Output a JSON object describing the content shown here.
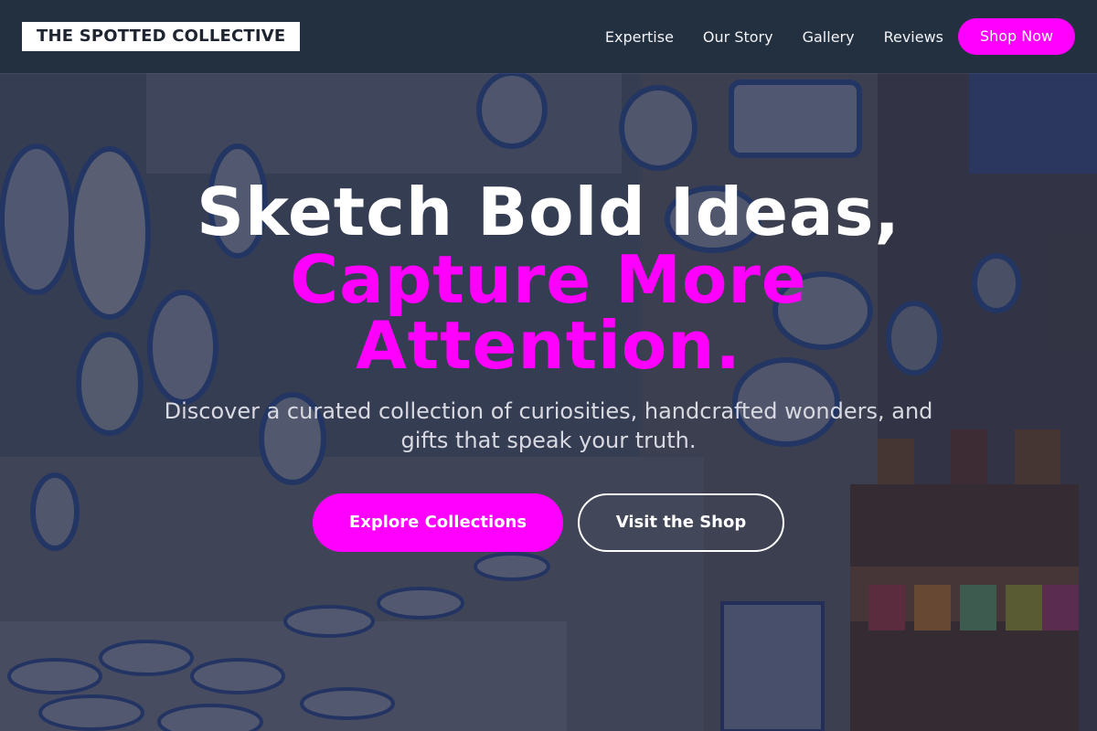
{
  "navbar": {
    "brand": "THE SPOTTED COLLECTIVE",
    "links": [
      "Expertise",
      "Our Story",
      "Gallery",
      "Reviews"
    ],
    "cta": "Shop Now"
  },
  "hero": {
    "headline_line1": "Sketch Bold Ideas,",
    "headline_line2": "Capture More",
    "headline_line3": "Attention.",
    "subtitle": "Discover a curated collection of curiosities, handcrafted wonders, and gifts that speak your truth.",
    "primary_button": "Explore Collections",
    "secondary_button": "Visit the Shop",
    "background_image": "pottery-shop-photo"
  },
  "colors": {
    "accent": "#ff00ff",
    "navbar_bg": "#23303f",
    "text_light": "#ffffff"
  }
}
